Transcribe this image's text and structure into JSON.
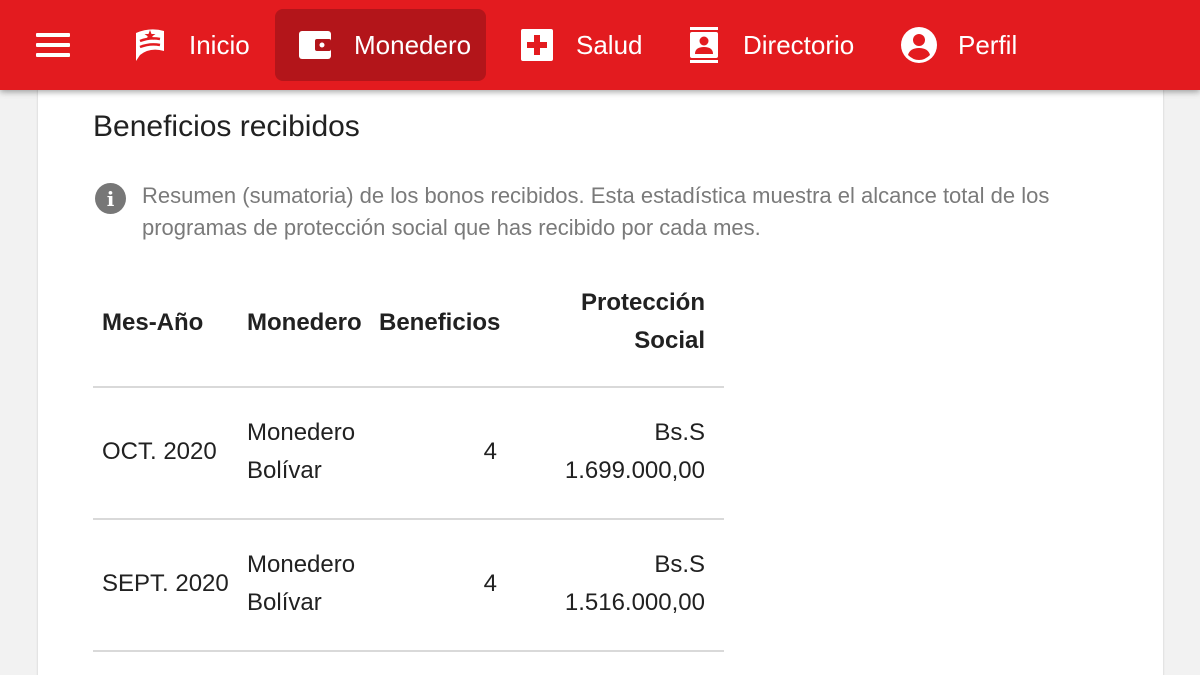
{
  "colors": {
    "header_bg": "#e31b1f",
    "active_tab_bg": "#b3151a",
    "text_muted": "#7a7a7a"
  },
  "nav": {
    "menu_icon": "hamburger-menu-icon",
    "items": [
      {
        "label": "Inicio",
        "icon": "flag-logo-icon",
        "active": false
      },
      {
        "label": "Monedero",
        "icon": "wallet-icon",
        "active": true
      },
      {
        "label": "Salud",
        "icon": "health-cross-icon",
        "active": false
      },
      {
        "label": "Directorio",
        "icon": "contacts-book-icon",
        "active": false
      },
      {
        "label": "Perfil",
        "icon": "user-circle-icon",
        "active": false
      }
    ]
  },
  "section": {
    "title": "Beneficios recibidos",
    "info_icon": "info-icon",
    "info_line1": "Resumen (sumatoria) de los bonos recibidos. Esta estadística muestra el alcance total de los",
    "info_line2": "programas de protección social que has recibido por cada mes."
  },
  "table": {
    "headers": {
      "month": "Mes-Año",
      "wallet": "Monedero",
      "benefits": "Beneficios",
      "social_line1": "Protección",
      "social_line2": "Social"
    },
    "rows": [
      {
        "month": "OCT. 2020",
        "wallet_line1": "Monedero",
        "wallet_line2": "Bolívar",
        "benefits": "4",
        "amount_line1": "Bs.S",
        "amount_line2": "1.699.000,00"
      },
      {
        "month": "SEPT. 2020",
        "wallet_line1": "Monedero",
        "wallet_line2": "Bolívar",
        "benefits": "4",
        "amount_line1": "Bs.S",
        "amount_line2": "1.516.000,00"
      }
    ]
  }
}
